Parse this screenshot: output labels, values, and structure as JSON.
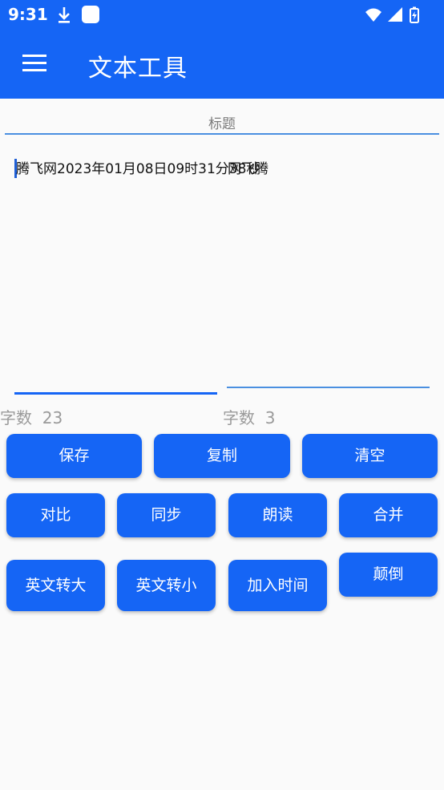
{
  "status": {
    "time": "9:31"
  },
  "app": {
    "title": "文本工具"
  },
  "editor": {
    "title_hint": "标题",
    "content": "腾飞网2023年01月08日09时31分38秒",
    "content_extra": "网飞腾",
    "count_left_label": "字数",
    "count_left_value": "23",
    "count_right_label": "字数",
    "count_right_value": "3"
  },
  "buttons": {
    "save": "保存",
    "copy": "复制",
    "clear": "清空",
    "compare": "对比",
    "sync": "同步",
    "read": "朗读",
    "merge": "合并",
    "upper": "英文转大",
    "lower": "英文转小",
    "add_time": "加入时间",
    "reverse": "颠倒"
  },
  "colors": {
    "primary": "#1565f5",
    "background": "#fafafa"
  }
}
